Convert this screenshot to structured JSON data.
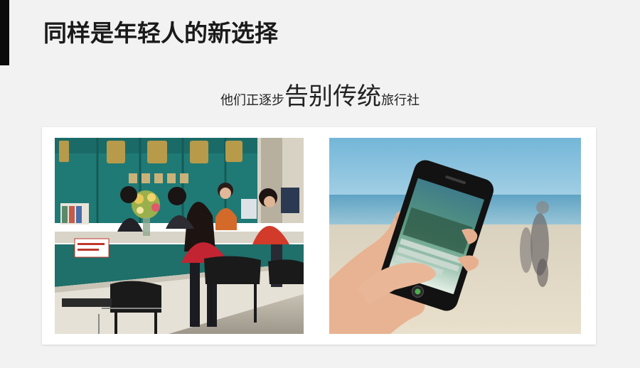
{
  "slide": {
    "title": "同样是年轻人的新选择",
    "subtitle": {
      "before": "他们正逐步",
      "highlight": "告别传统",
      "after": "旅行社"
    }
  },
  "photos": [
    {
      "name": "travel-agency-counter-photo",
      "sign_text": "国旅行社"
    },
    {
      "name": "smartphone-beach-photo"
    }
  ],
  "colors": {
    "background": "#f2f2f2",
    "accent_bar": "#0b0b0b",
    "title": "#1a1a1a",
    "card": "#ffffff"
  }
}
